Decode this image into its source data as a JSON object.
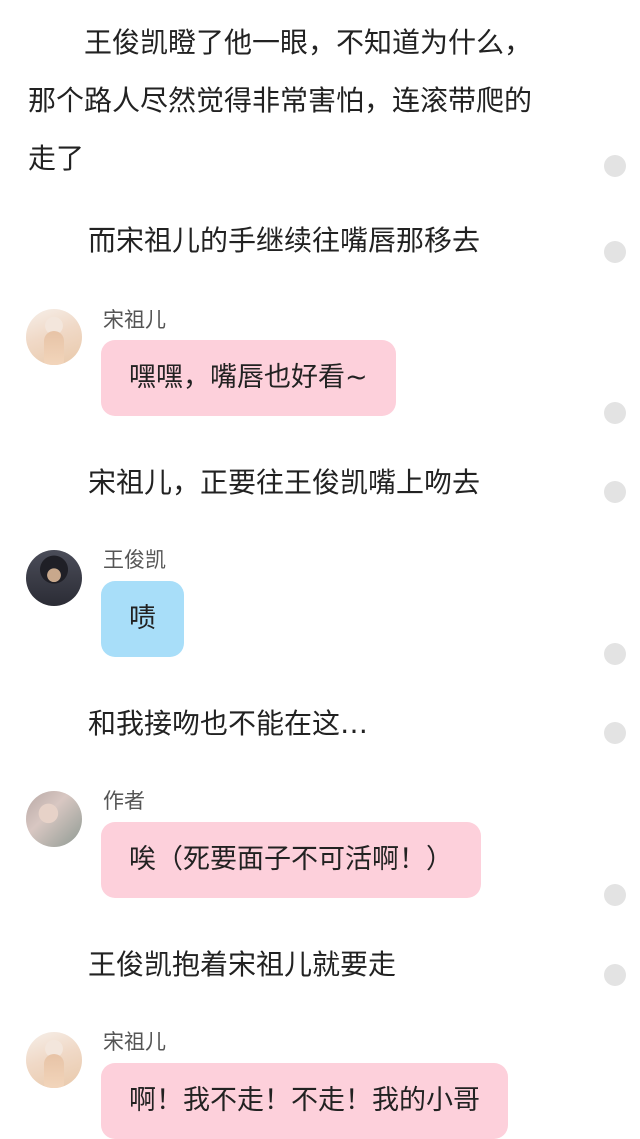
{
  "messages": {
    "n1": {
      "text": "　　王俊凯瞪了他一眼，不知道为什么，\n那个路人尽然觉得非常害怕，连滚带爬的\n走了"
    },
    "n2": {
      "text": "而宋祖儿的手继续往嘴唇那移去"
    },
    "c1": {
      "speaker": "宋祖儿",
      "text": "嘿嘿，嘴唇也好看~",
      "avatar": "woman-in-gown-avatar",
      "color": "#fdd0db"
    },
    "n3": {
      "text": "宋祖儿，正要往王俊凯嘴上吻去"
    },
    "c2": {
      "speaker": "王俊凯",
      "text": "啧",
      "avatar": "man-portrait-avatar",
      "color": "#a8def9"
    },
    "n4": {
      "text": "和我接吻也不能在这…"
    },
    "c3": {
      "speaker": "作者",
      "text": "唉（死要面子不可活啊！）",
      "avatar": "author-avatar",
      "color": "#fdd0db"
    },
    "n5": {
      "text": "王俊凯抱着宋祖儿就要走"
    },
    "c4": {
      "speaker": "宋祖儿",
      "text": "啊！我不走！不走！我的小哥",
      "avatar": "woman-in-gown-avatar",
      "color": "#fdd0db"
    }
  }
}
